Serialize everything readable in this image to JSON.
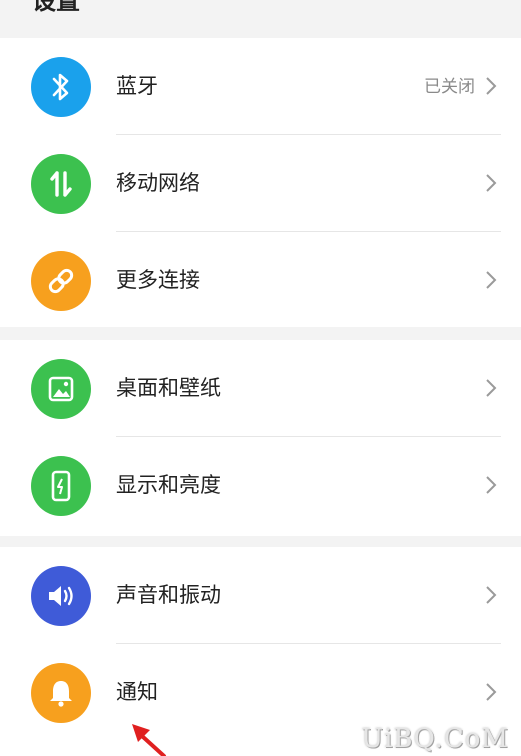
{
  "header": {
    "title": "设置"
  },
  "groups": [
    {
      "items": [
        {
          "label": "蓝牙",
          "value": "已关闭",
          "icon": "bluetooth-icon",
          "color": "#1aa1ec"
        },
        {
          "label": "移动网络",
          "icon": "mobile-data-icon",
          "color": "#3cc14f"
        },
        {
          "label": "更多连接",
          "icon": "link-icon",
          "color": "#f7a01e"
        }
      ]
    },
    {
      "items": [
        {
          "label": "桌面和壁纸",
          "icon": "wallpaper-icon",
          "color": "#3cc14f"
        },
        {
          "label": "显示和亮度",
          "icon": "display-brightness-icon",
          "color": "#3cc14f"
        }
      ]
    },
    {
      "items": [
        {
          "label": "声音和振动",
          "icon": "sound-icon",
          "color": "#3f5bd8"
        },
        {
          "label": "通知",
          "icon": "bell-icon",
          "color": "#f7a01e"
        }
      ]
    }
  ],
  "watermark": "UiBQ.CoM",
  "annotation": {
    "color": "#e02020"
  }
}
